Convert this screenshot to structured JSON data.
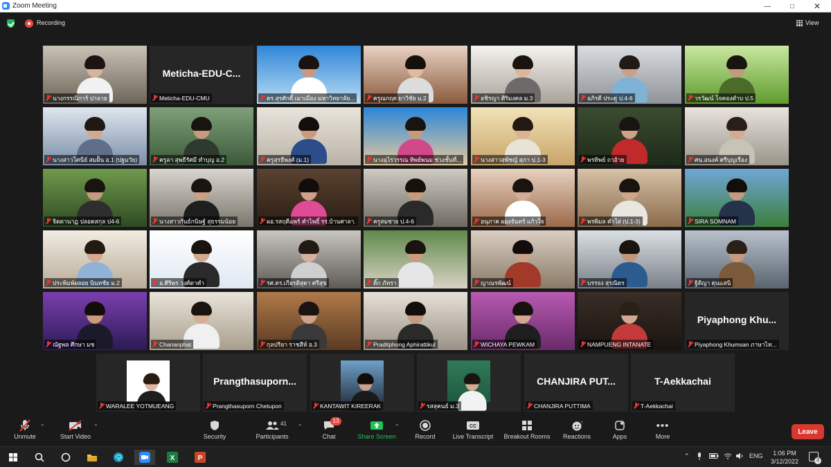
{
  "window": {
    "title": "Zoom Meeting"
  },
  "topbar": {
    "recording_label": "Recording",
    "view_label": "View"
  },
  "gallery": {
    "tiles": [
      {
        "name": "นางกรรณิการ์ ปาลาย",
        "video": true,
        "bg": [
          "#c9c2b6",
          "#6d6558"
        ],
        "skin": "#d8b39c",
        "hair": "#1c1410",
        "shirt": "#f1f1f1"
      },
      {
        "name": "Meticha-EDU-CMU",
        "video": false,
        "display": "Meticha-EDU-C..."
      },
      {
        "name": "ดร.สุรศักดิ์ เมาเมือง มหาวิทยาลัย...",
        "video": true,
        "bg": [
          "#2f86d8",
          "#b9dcf3"
        ],
        "skin": "#c79a80",
        "hair": "#1a1410",
        "shirt": "#ffffff"
      },
      {
        "name": "ครูณกฤต ยาวิชัย ม.2",
        "video": true,
        "bg": [
          "#e8d2c4",
          "#8b5a3c"
        ],
        "skin": "#e0b9a0",
        "hair": "#14100c",
        "shirt": "#dcdcdc"
      },
      {
        "name": "อชิรญา ศิริมงคล ม.3",
        "video": true,
        "bg": [
          "#f5f3ee",
          "#a9a39a"
        ],
        "skin": "#dcb69c",
        "hair": "#1a1411",
        "shirt": "#6f6a6a"
      },
      {
        "name": "อภิรดี ประดู่ ป.4-6",
        "video": true,
        "bg": [
          "#d9dde2",
          "#8f9398"
        ],
        "skin": "#c9a088",
        "hair": "#221a15",
        "shirt": "#7eb2d6"
      },
      {
        "name": "วรวัฒน์ โจคองตำบ ป.5",
        "video": true,
        "bg": [
          "#c9e7a1",
          "#5f9c2d"
        ],
        "skin": "#c49a7c",
        "hair": "#1a1410",
        "shirt": "#4a6b2a"
      },
      {
        "name": "นางสาวโศนีย์ สมฝั้น อ.1 (ปฐมวัย)",
        "video": true,
        "bg": [
          "#dfe6ee",
          "#7a8ea8"
        ],
        "skin": "#d2a98f",
        "hair": "#1f1813",
        "shirt": "#5f6e8a"
      },
      {
        "name": "ครูลา สุพธีรัศมี ทำบุญ อ.2",
        "video": true,
        "bg": [
          "#7fa07a",
          "#3c5a3a"
        ],
        "skin": "#c59c80",
        "hair": "#1a1410",
        "shirt": "#2f3a2e"
      },
      {
        "name": "ครูสุรธีพงศ์ (ม.1)",
        "video": true,
        "bg": [
          "#e9e4dc",
          "#b9b2a6"
        ],
        "skin": "#c99b7c",
        "hair": "#120e0b",
        "shirt": "#2c4c8a"
      },
      {
        "name": "นางอุไรวรรณ ทิพย์พนม ช่วงชั้นที่...",
        "video": true,
        "bg": [
          "#2b86d9",
          "#e4c9a0"
        ],
        "skin": "#c69a7c",
        "hair": "#1a1410",
        "shirt": "#d04a8a"
      },
      {
        "name": "นางสาวสุพัชญ์ สุภา ป.1-3",
        "video": true,
        "bg": [
          "#f2e3b8",
          "#c8a46a"
        ],
        "skin": "#dcb194",
        "hair": "#231913",
        "shirt": "#e9e2d6"
      },
      {
        "name": "พรทิพย์ ถาอ้าย",
        "video": true,
        "bg": [
          "#3b4d30",
          "#1f2a1a"
        ],
        "skin": "#cfa188",
        "hair": "#1a1410",
        "shirt": "#c02a2a"
      },
      {
        "name": "ศน.อนงค์ ศรีบุญเรือง",
        "video": true,
        "bg": [
          "#e8e4dc",
          "#9a948a"
        ],
        "skin": "#d4ab92",
        "hair": "#2a1f18",
        "shirt": "#c9c2b6"
      },
      {
        "name": "จิตตานาฏ ปลอดสกุล ป4-6",
        "video": true,
        "bg": [
          "#6f9a4e",
          "#2f4a22"
        ],
        "skin": "#c49a80",
        "hair": "#1a1410",
        "shirt": "#2e2e2e"
      },
      {
        "name": "นางสาวกันธ์กนิษฐ์ สุธรรมน้อย",
        "video": true,
        "bg": [
          "#d9d6cf",
          "#7a756c"
        ],
        "skin": "#caa088",
        "hair": "#1a1410",
        "shirt": "#1e1e1e"
      },
      {
        "name": "ผอ.รสฤดีแพร์ คำไพธิ์ รร.บ้านศาลา...",
        "video": true,
        "active": true,
        "bg": [
          "#5a4230",
          "#2a1d14"
        ],
        "skin": "#cfa08a",
        "hair": "#120d0a",
        "shirt": "#e04a96"
      },
      {
        "name": "ครูสมชาย ป.4-6",
        "video": true,
        "bg": [
          "#cfcac2",
          "#6e6a62"
        ],
        "skin": "#c79a7e",
        "hair": "#16110d",
        "shirt": "#2a2a2a"
      },
      {
        "name": "อนุภาค ผองจันทร์ แก้วใจ",
        "video": true,
        "bg": [
          "#e7d2c0",
          "#9b6a4a"
        ],
        "skin": "#d4ac94",
        "hair": "#1a1410",
        "shirt": "#ffffff"
      },
      {
        "name": "พรพิมล คำใส่ (ป.1-3)",
        "video": true,
        "bg": [
          "#d7c2a8",
          "#8a6a4a"
        ],
        "skin": "#cfa58a",
        "hair": "#1a1410",
        "shirt": "#e9e6e0"
      },
      {
        "name": "SIRA SOMNAM",
        "video": true,
        "bg": [
          "#6fa6d6",
          "#3c7f3c"
        ],
        "skin": "#c49a7e",
        "hair": "#120e0b",
        "shirt": "#24324a"
      },
      {
        "name": "ประพิมพ์ผลอย นินทชัย ม.2",
        "video": true,
        "bg": [
          "#f2ece2",
          "#b8ab98"
        ],
        "skin": "#d4ab92",
        "hair": "#241a14",
        "shirt": "#8fb2d6"
      },
      {
        "name": "อ.ศิริพร วงศ์ตาคำ",
        "video": true,
        "bg": [
          "#ffffff",
          "#dfe8f2"
        ],
        "skin": "#d2a98e",
        "hair": "#1a1410",
        "shirt": "#2a2a2a"
      },
      {
        "name": "รศ.ดร.เกียรติสุดา ศรีสุข",
        "video": true,
        "bg": [
          "#c9c6c1",
          "#5e5a55"
        ],
        "skin": "#d6b09a",
        "hair": "#241a15",
        "shirt": "#cfcfcf"
      },
      {
        "name": "ติ๊ก ภัทรา",
        "video": true,
        "bg": [
          "#5f8a4a",
          "#d9d2c6"
        ],
        "skin": "#c99c80",
        "hair": "#1a1410",
        "shirt": "#e6e6e6"
      },
      {
        "name": "ญาณรพัฒน์",
        "video": true,
        "bg": [
          "#d9cfc2",
          "#8a7a68"
        ],
        "skin": "#c9a088",
        "hair": "#120d0a",
        "shirt": "#a23a2a"
      },
      {
        "name": "บรรจง สุรณิตร",
        "video": true,
        "bg": [
          "#dbe0e4",
          "#7a8088"
        ],
        "skin": "#c29678",
        "hair": "#1a1410",
        "shirt": "#2c5b8f"
      },
      {
        "name": "ฐิติญา ดุนแสนิ",
        "video": true,
        "bg": [
          "#b9c2cc",
          "#5a646e"
        ],
        "skin": "#c79a7e",
        "hair": "#2a2018",
        "shirt": "#7a5a3a"
      },
      {
        "name": "ณัฐพล ศึกษา มช",
        "video": true,
        "bg": [
          "#7b3fb0",
          "#2c1a55"
        ],
        "skin": "#c99a7c",
        "hair": "#120d0a",
        "shirt": "#1a1a2a"
      },
      {
        "name": "Chananphat",
        "video": true,
        "bg": [
          "#e9e4da",
          "#a89e8e"
        ],
        "skin": "#d6ae94",
        "hair": "#1a1410",
        "shirt": "#f0f0f0"
      },
      {
        "name": "กุลปริยา ราชสีห์ อ.3",
        "video": true,
        "bg": [
          "#b07a4a",
          "#5a3a22"
        ],
        "skin": "#cfa28a",
        "hair": "#1a1410",
        "shirt": "#3a3a3a"
      },
      {
        "name": "Praditphong Aphirattikul",
        "video": true,
        "bg": [
          "#e6e1d8",
          "#9a9286"
        ],
        "skin": "#c69a7e",
        "hair": "#120d0a",
        "shirt": "#2a2a2a"
      },
      {
        "name": "WICHAYA PEWKAM",
        "video": true,
        "bg": [
          "#b85ab2",
          "#6a2a6a"
        ],
        "skin": "#d2a88e",
        "hair": "#16110d",
        "shirt": "#1e1e1e"
      },
      {
        "name": "NAMPUENG INTANATE",
        "video": true,
        "bg": [
          "#3a2e26",
          "#1a1410"
        ],
        "skin": "#d2a98e",
        "hair": "#2a2018",
        "shirt": "#c43a3a"
      },
      {
        "name": "Piyaphong Khumsan ภาษาไท...",
        "video": false,
        "display": "Piyaphong  Khu..."
      },
      {
        "name": "WARALEE YOTMUEANG",
        "video": false,
        "photo": true,
        "bg": [
          "#ffffff",
          "#ffffff"
        ],
        "skin": "#e0b8a0",
        "hair": "#2a1a12",
        "shirt": "#1e1e1e"
      },
      {
        "name": "Prangthasuporn Chetupon",
        "video": false,
        "display": "Prangthasuporn..."
      },
      {
        "name": "KANTAWIT KIREERAK",
        "video": false,
        "photo": true,
        "bg": [
          "#6fa0c8",
          "#2c3a4a"
        ],
        "skin": "#cfa088",
        "hair": "#120d0a",
        "shirt": "#1a1a1a"
      },
      {
        "name": "รสสุคนธ์ ม.3",
        "video": false,
        "photo": true,
        "bg": [
          "#2f7a58",
          "#1f5a40"
        ],
        "skin": "#d4ab92",
        "hair": "#1a1410",
        "shirt": "#f2f2f2"
      },
      {
        "name": "CHANJIRA PUTTIMA",
        "video": false,
        "display": "CHANJIRA  PUT..."
      },
      {
        "name": "T-Aekkachai",
        "video": false,
        "display": "T-Aekkachai"
      }
    ]
  },
  "toolbar": {
    "unmute": "Unmute",
    "start_video": "Start Video",
    "security": "Security",
    "participants": "Participants",
    "participants_count": "41",
    "chat": "Chat",
    "chat_badge": "13",
    "share_screen": "Share Screen",
    "record": "Record",
    "live_transcript": "Live Transcript",
    "breakout_rooms": "Breakout Rooms",
    "reactions": "Reactions",
    "apps": "Apps",
    "more": "More",
    "leave": "Leave",
    "colors": {
      "share_green": "#22c25a",
      "leave_red": "#d9382e",
      "active_speaker": "#b9e335"
    }
  },
  "taskbar": {
    "lang": "ENG",
    "time": "1:06 PM",
    "date": "3/12/2022",
    "notifications": "3",
    "apps": [
      "windows-icon",
      "search-icon",
      "task-view-icon",
      "file-explorer-icon",
      "edge-icon",
      "zoom-icon",
      "excel-icon",
      "powerpoint-icon"
    ]
  }
}
